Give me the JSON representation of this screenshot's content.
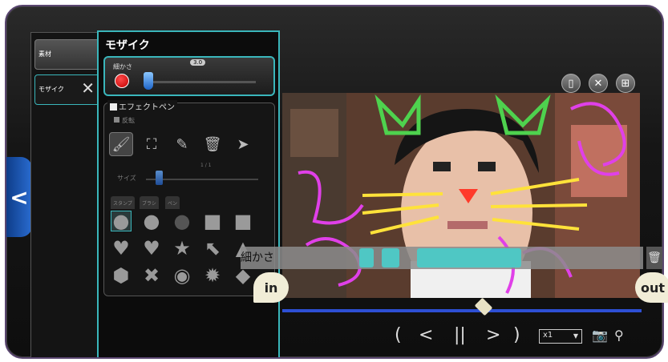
{
  "list": {
    "item1": "素材",
    "item2": "モザイク"
  },
  "side_tab_glyph": "<",
  "mosaic": {
    "title": "モザイク",
    "density_label": "細かさ",
    "density_value": "3.0",
    "density_level": 0.05
  },
  "effect": {
    "title": "エフェクトペン",
    "subcheck": "反転",
    "size_label": "サイズ",
    "size_dims": "1 / 1",
    "size_level": 0.1,
    "shape_tabs": [
      "スタンプ",
      "ブラシ",
      "ペン"
    ]
  },
  "caption": {
    "label": "細かさ"
  },
  "timeline": {
    "in_label": "in",
    "out_label": "out",
    "position": 0.56
  },
  "controls": {
    "speed": "x1"
  },
  "colors": {
    "accent": "#3ab6bb",
    "timeline": "#2d4fd4",
    "record": "#e02020"
  }
}
